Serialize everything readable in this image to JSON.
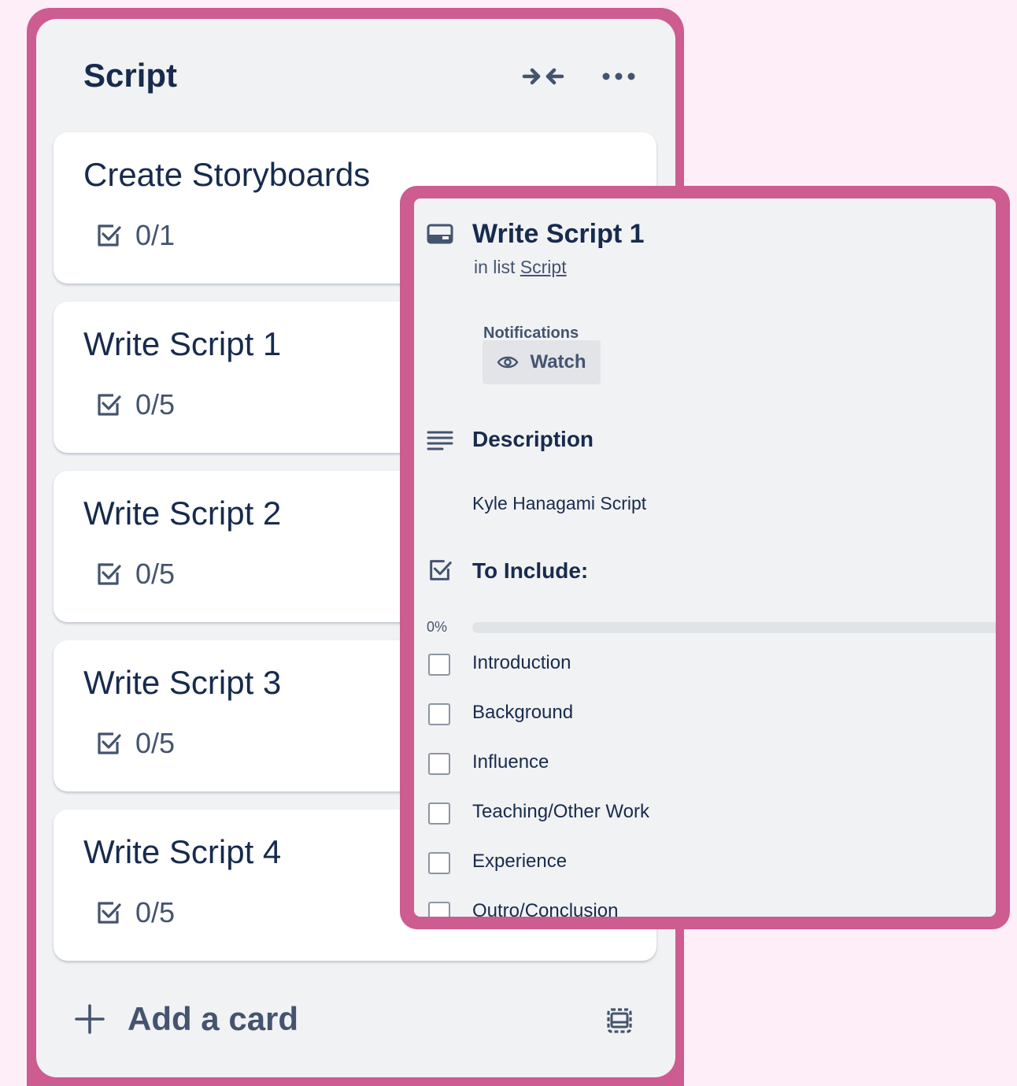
{
  "list": {
    "title": "Script",
    "collapse_icon": "collapse-arrows-icon",
    "more_icon": "more-horizontal-icon",
    "cards": [
      {
        "title": "Create Storyboards",
        "checklist_badge": "0/1"
      },
      {
        "title": "Write Script 1",
        "checklist_badge": "0/5"
      },
      {
        "title": "Write Script 2",
        "checklist_badge": "0/5"
      },
      {
        "title": "Write Script 3",
        "checklist_badge": "0/5"
      },
      {
        "title": "Write Script 4",
        "checklist_badge": "0/5"
      }
    ],
    "add_card_label": "Add a card",
    "template_icon": "card-template-icon"
  },
  "card_detail": {
    "title": "Write Script 1",
    "in_list_prefix": "in list",
    "list_name": "Script",
    "notifications_label": "Notifications",
    "watch_label": "Watch",
    "description_heading": "Description",
    "description_text": "Kyle Hanagami Script",
    "checklist": {
      "title": "To Include:",
      "progress_label": "0%",
      "progress": 0,
      "items": [
        {
          "label": "Introduction",
          "checked": false
        },
        {
          "label": "Background",
          "checked": false
        },
        {
          "label": "Influence",
          "checked": false
        },
        {
          "label": "Teaching/Other Work",
          "checked": false
        },
        {
          "label": "Experience",
          "checked": false
        },
        {
          "label": "Outro/Conclusion",
          "checked": false
        }
      ]
    }
  },
  "colors": {
    "background": "#fdeef8",
    "frame": "#cd5c90",
    "panel": "#f1f2f4",
    "text": "#172b4d",
    "subtle_text": "#44546f"
  }
}
